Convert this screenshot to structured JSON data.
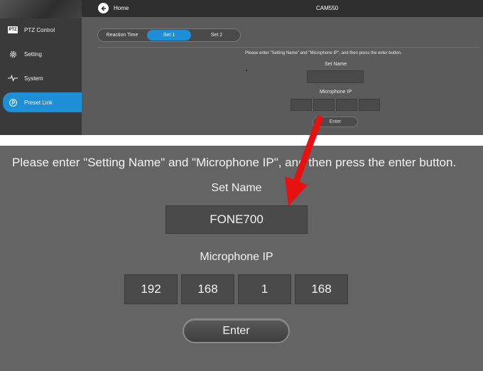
{
  "sidebar": {
    "items": [
      {
        "label": "PTZ Control",
        "icon": "ptz-icon"
      },
      {
        "label": "Setting",
        "icon": "gear-icon"
      },
      {
        "label": "System",
        "icon": "pulse-icon"
      },
      {
        "label": "Preset Link",
        "icon": "preset-link-icon"
      }
    ]
  },
  "topbar": {
    "home_label": "Home",
    "title": "CAM550"
  },
  "tabs": [
    {
      "label": "Reaction Time"
    },
    {
      "label": "Set 1"
    },
    {
      "label": "Set 2"
    }
  ],
  "form": {
    "instruction": "Please enter \"Setting Name\" and \"Microphone IP\", and then press the enter button.",
    "set_name_label": "Set Name",
    "set_name_value": "FONE700",
    "mic_ip_label": "Microphone IP",
    "mic_ip": [
      "192",
      "168",
      "1",
      "168"
    ],
    "enter_label": "Enter"
  },
  "colors": {
    "accent": "#1e8fd6",
    "annotation_arrow": "#e8110f"
  }
}
